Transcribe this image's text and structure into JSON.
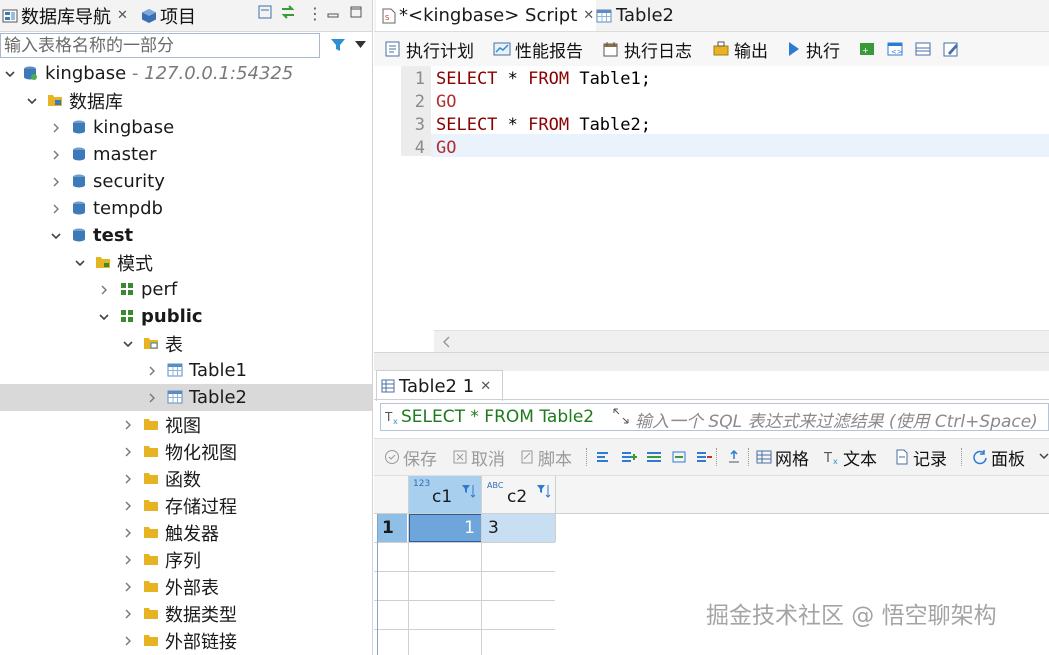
{
  "left_panel": {
    "tabs": [
      {
        "label": "数据库导航",
        "icon": "database-navigator-icon"
      },
      {
        "label": "项目",
        "icon": "project-cube-icon"
      }
    ],
    "filter_placeholder": "输入表格名称的一部分",
    "tree": {
      "connection": {
        "label": "kingbase",
        "address": "- 127.0.0.1:54325"
      },
      "databases_folder": "数据库",
      "databases": [
        "kingbase",
        "master",
        "security",
        "tempdb",
        "test"
      ],
      "schemas_folder": "模式",
      "schemas": [
        "perf",
        "public"
      ],
      "tables_folder": "表",
      "tables": [
        "Table1",
        "Table2"
      ],
      "public_folders": [
        "视图",
        "物化视图",
        "函数",
        "存储过程",
        "触发器",
        "序列",
        "外部表",
        "数据类型",
        "外部链接"
      ]
    }
  },
  "editor": {
    "tabs": [
      {
        "label": "*<kingbase> Script",
        "icon": "sql-script-icon"
      },
      {
        "label": "Table2",
        "icon": "table-icon"
      }
    ],
    "toolbar": [
      {
        "label": "执行计划",
        "icon": "explain-plan-icon"
      },
      {
        "label": "性能报告",
        "icon": "performance-report-icon"
      },
      {
        "label": "执行日志",
        "icon": "execution-log-icon"
      },
      {
        "label": "输出",
        "icon": "output-icon"
      },
      {
        "label": "执行",
        "icon": "run-icon"
      }
    ],
    "lines": [
      {
        "num": "1",
        "parts": [
          "SELECT",
          " * ",
          "FROM",
          " Table1;"
        ]
      },
      {
        "num": "2",
        "parts": [
          "GO"
        ]
      },
      {
        "num": "3",
        "parts": [
          "SELECT",
          " * ",
          "FROM",
          " Table2;"
        ]
      },
      {
        "num": "4",
        "parts": [
          "GO"
        ]
      }
    ]
  },
  "results": {
    "tab_label": "Table2 1",
    "query_text": "SELECT * FROM Table2",
    "filter_placeholder": "输入一个 SQL 表达式来过滤结果 (使用 Ctrl+Space)",
    "toolbar": {
      "save": "保存",
      "cancel": "取消",
      "script": "脚本",
      "grid": "网格",
      "text": "文本",
      "record": "记录",
      "panels": "面板"
    },
    "columns": [
      {
        "name": "c1",
        "type_badge": "123"
      },
      {
        "name": "c2",
        "type_badge": "ABC"
      }
    ],
    "rows": [
      {
        "num": "1",
        "values": [
          "1",
          "3"
        ]
      }
    ]
  },
  "watermark": "掘金技术社区 @ 悟空聊架构",
  "colors": {
    "keyword": "#8b0000",
    "selected_row": "#d9d9d9",
    "grid_selected_cell": "#6ea6dc",
    "grid_header_selected": "#a8cfee",
    "folder": "#e6b422",
    "database": "#3d7ab8",
    "schema": "#3a8a2f"
  }
}
